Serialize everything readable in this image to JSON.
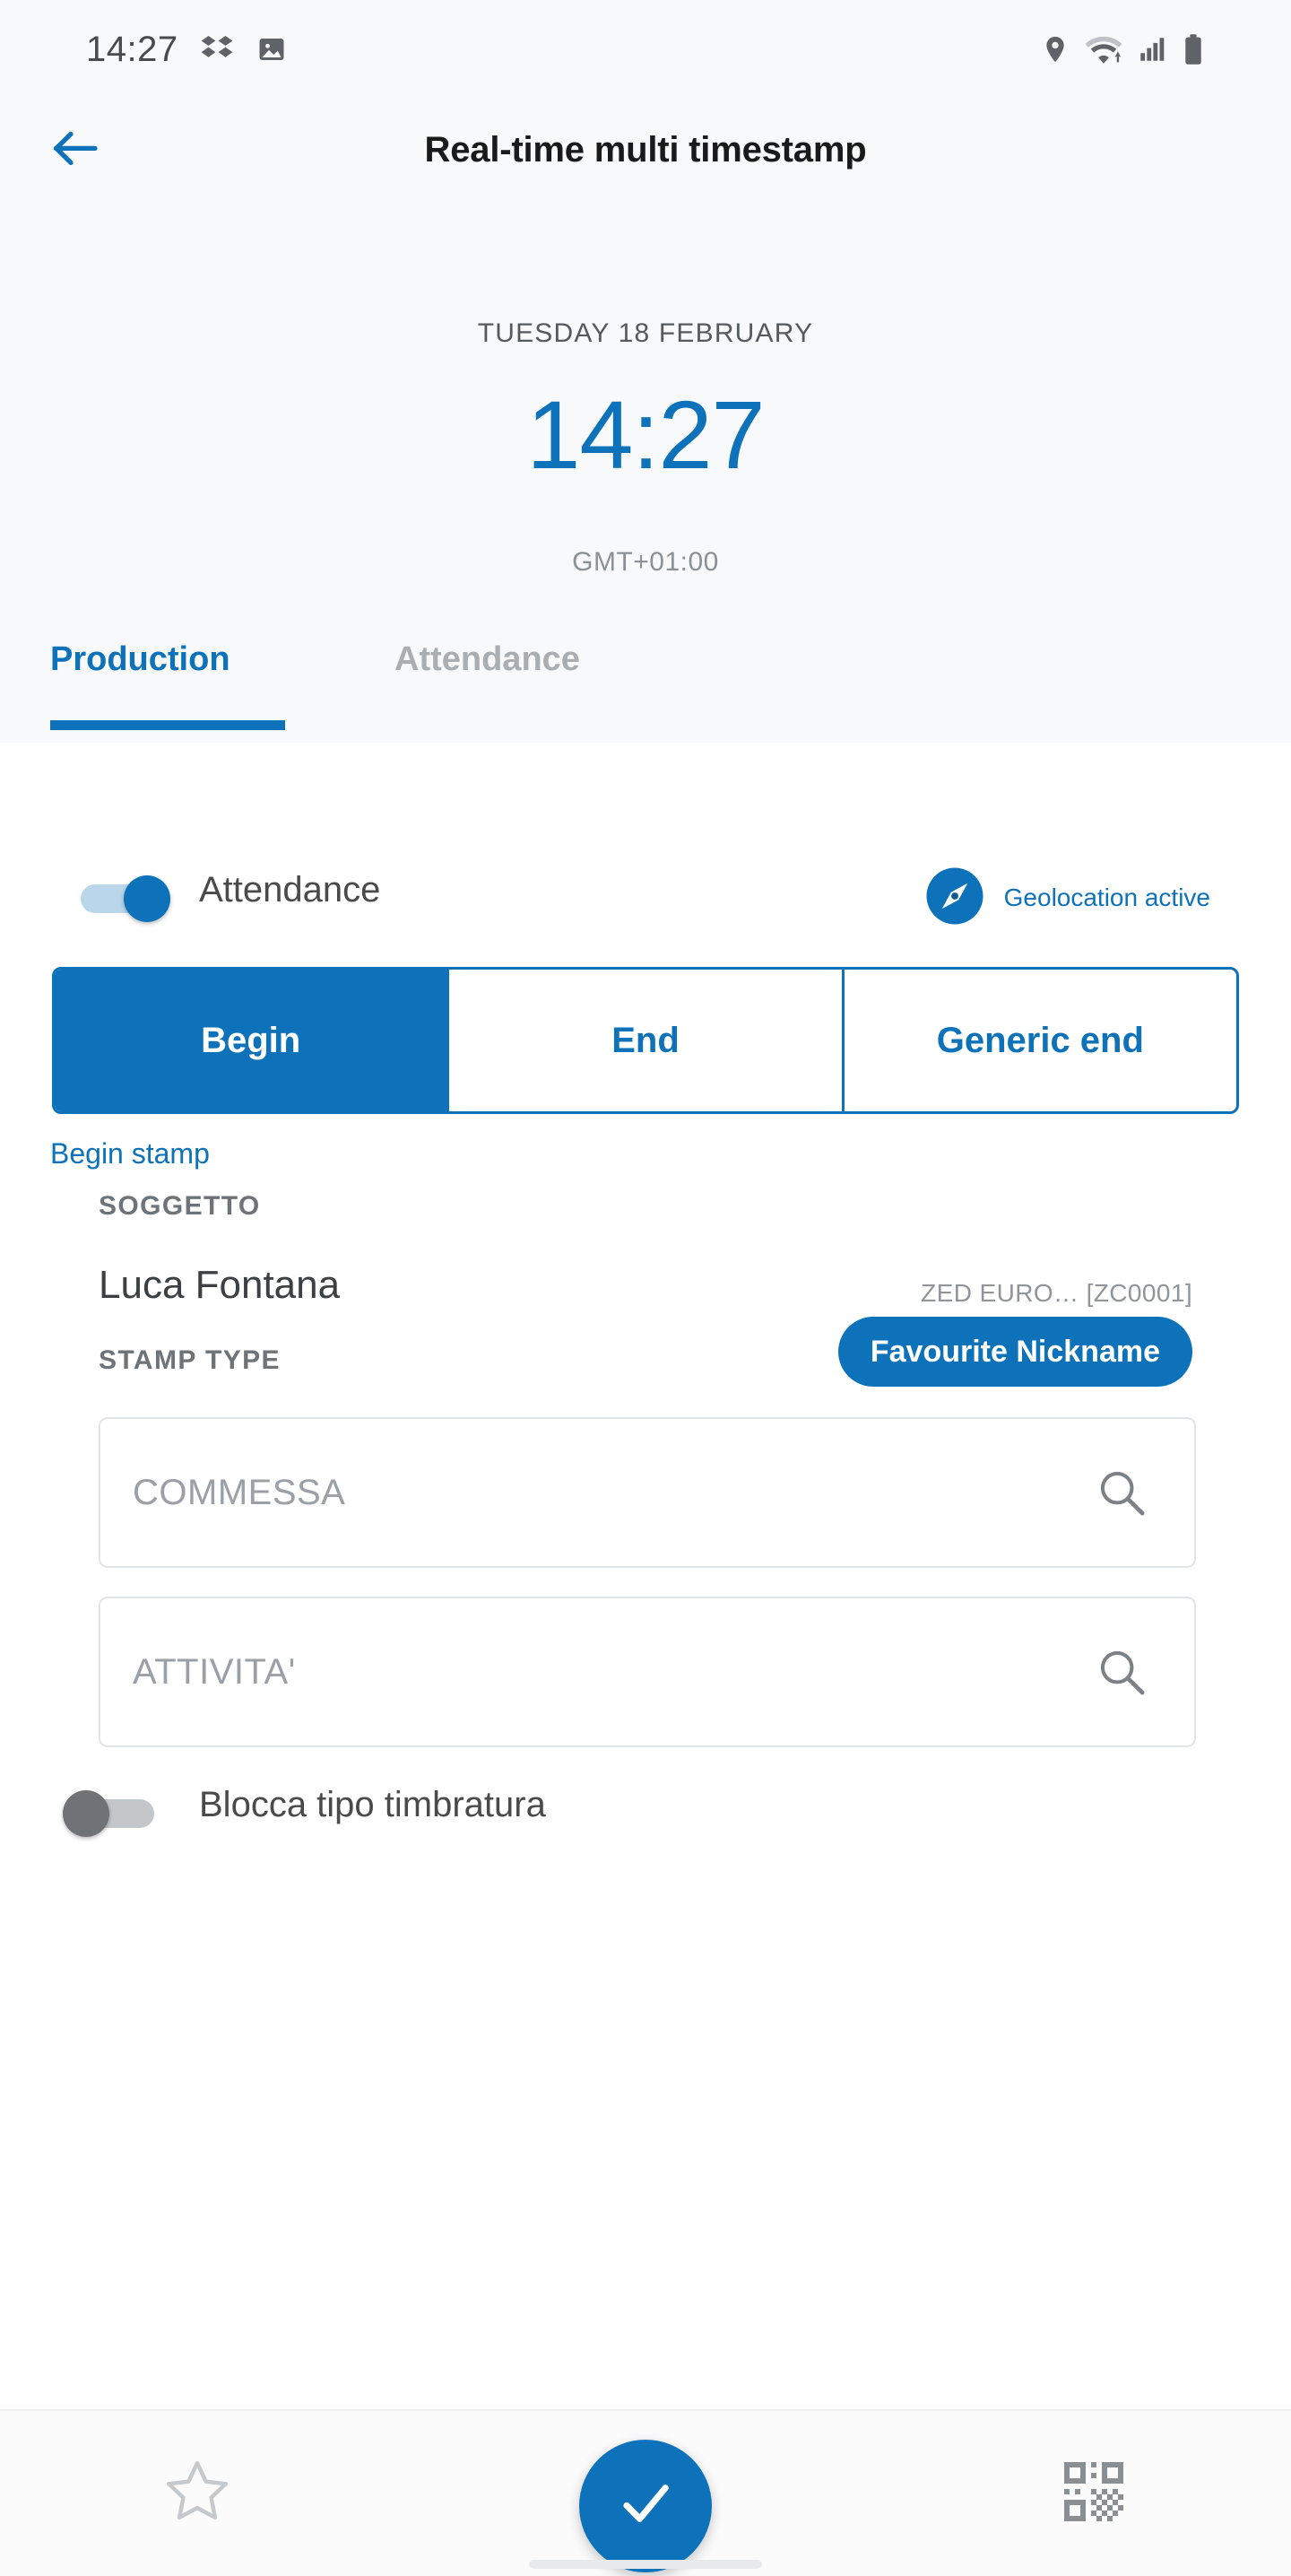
{
  "status_bar": {
    "time": "14:27",
    "left_icons": [
      "dropbox-icon",
      "gallery-icon"
    ],
    "right_icons": [
      "location-pin-icon",
      "wifi-icon",
      "cellular-signal-icon",
      "battery-icon"
    ]
  },
  "header": {
    "back_icon": "back-arrow-icon",
    "title": "Real-time multi timestamp",
    "date": "TUESDAY 18 FEBRUARY",
    "clock": "14:27",
    "timezone": "GMT+01:00"
  },
  "tabs": [
    {
      "label": "Production",
      "active": true
    },
    {
      "label": "Attendance",
      "active": false
    }
  ],
  "attendance_row": {
    "toggle_label": "Attendance",
    "toggle_on": true,
    "geolocation_icon": "compass-icon",
    "geolocation_label": "Geolocation active"
  },
  "segmented": {
    "options": [
      {
        "label": "Begin",
        "active": true
      },
      {
        "label": "End",
        "active": false
      },
      {
        "label": "Generic end",
        "active": false
      }
    ]
  },
  "form": {
    "begin_stamp_link": "Begin stamp",
    "subject_label": "SOGGETTO",
    "subject_name": "Luca Fontana",
    "subject_code": "ZED EURO… [ZC0001]",
    "stamp_type_label": "STAMP TYPE",
    "nickname_pill": "Favourite Nickname",
    "commessa_placeholder": "COMMESSA",
    "attivita_placeholder": "ATTIVITA'",
    "search_icon": "search-icon",
    "lock_toggle_label": "Blocca tipo timbratura",
    "lock_toggle_on": false
  },
  "bottom_bar": {
    "favourite_icon": "star-outline-icon",
    "confirm_icon": "check-icon",
    "qr_icon": "qr-code-icon"
  },
  "colors": {
    "accent": "#0d72b9",
    "header_bg": "#f8f9fa",
    "muted_text": "#8c9196",
    "label_text": "#6e7377",
    "inactive_tab": "#a9aeb3"
  }
}
